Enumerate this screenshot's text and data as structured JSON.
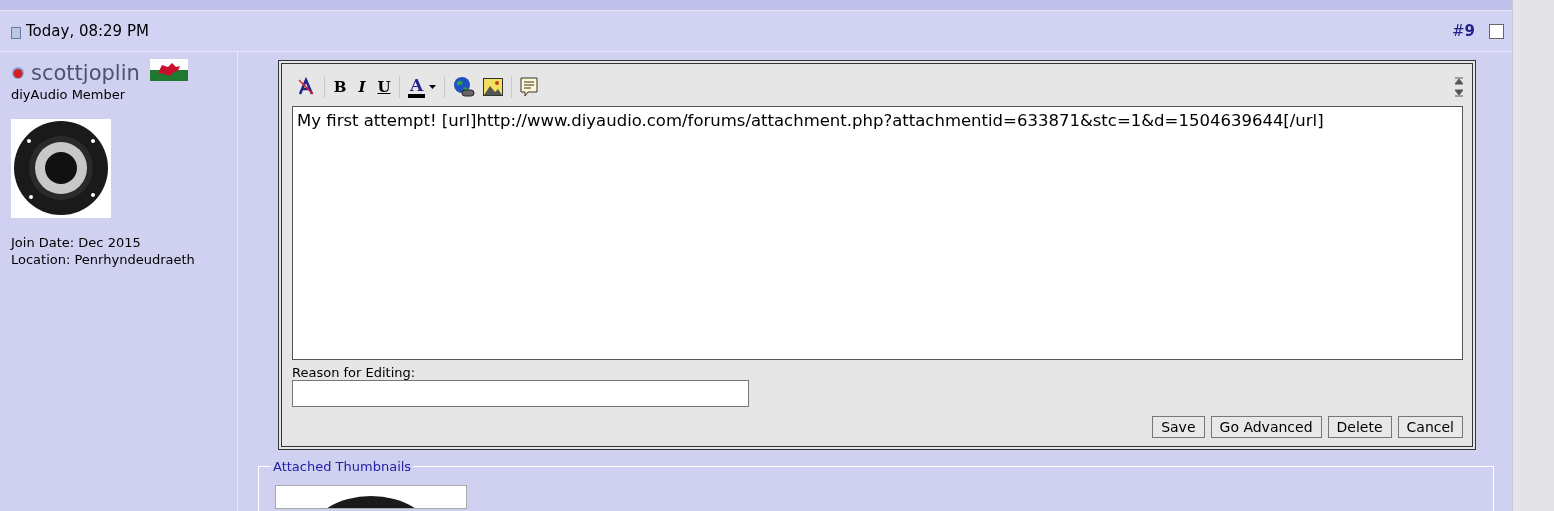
{
  "post": {
    "date": "Today, 08:29 PM",
    "number_prefix": "#",
    "number": "9",
    "checked": false
  },
  "user": {
    "name": "scottjoplin",
    "title": "diyAudio Member",
    "join_date": "Join Date: Dec 2015",
    "location": "Location: Penrhyndeudraeth"
  },
  "editor": {
    "format_buttons": [
      {
        "label": "B",
        "kind": "bold"
      },
      {
        "label": "I",
        "kind": "italic"
      },
      {
        "label": "U",
        "kind": "underline"
      }
    ],
    "color_letter": "A",
    "text": "My first attempt! [url]http://www.diyaudio.com/forums/attachment.php?attachmentid=633871&stc=1&d=1504639644[/url]",
    "reason_label": "Reason for Editing:",
    "buttons": [
      "Save",
      "Go Advanced",
      "Delete",
      "Cancel"
    ]
  },
  "attachments": {
    "legend": "Attached Thumbnails"
  }
}
